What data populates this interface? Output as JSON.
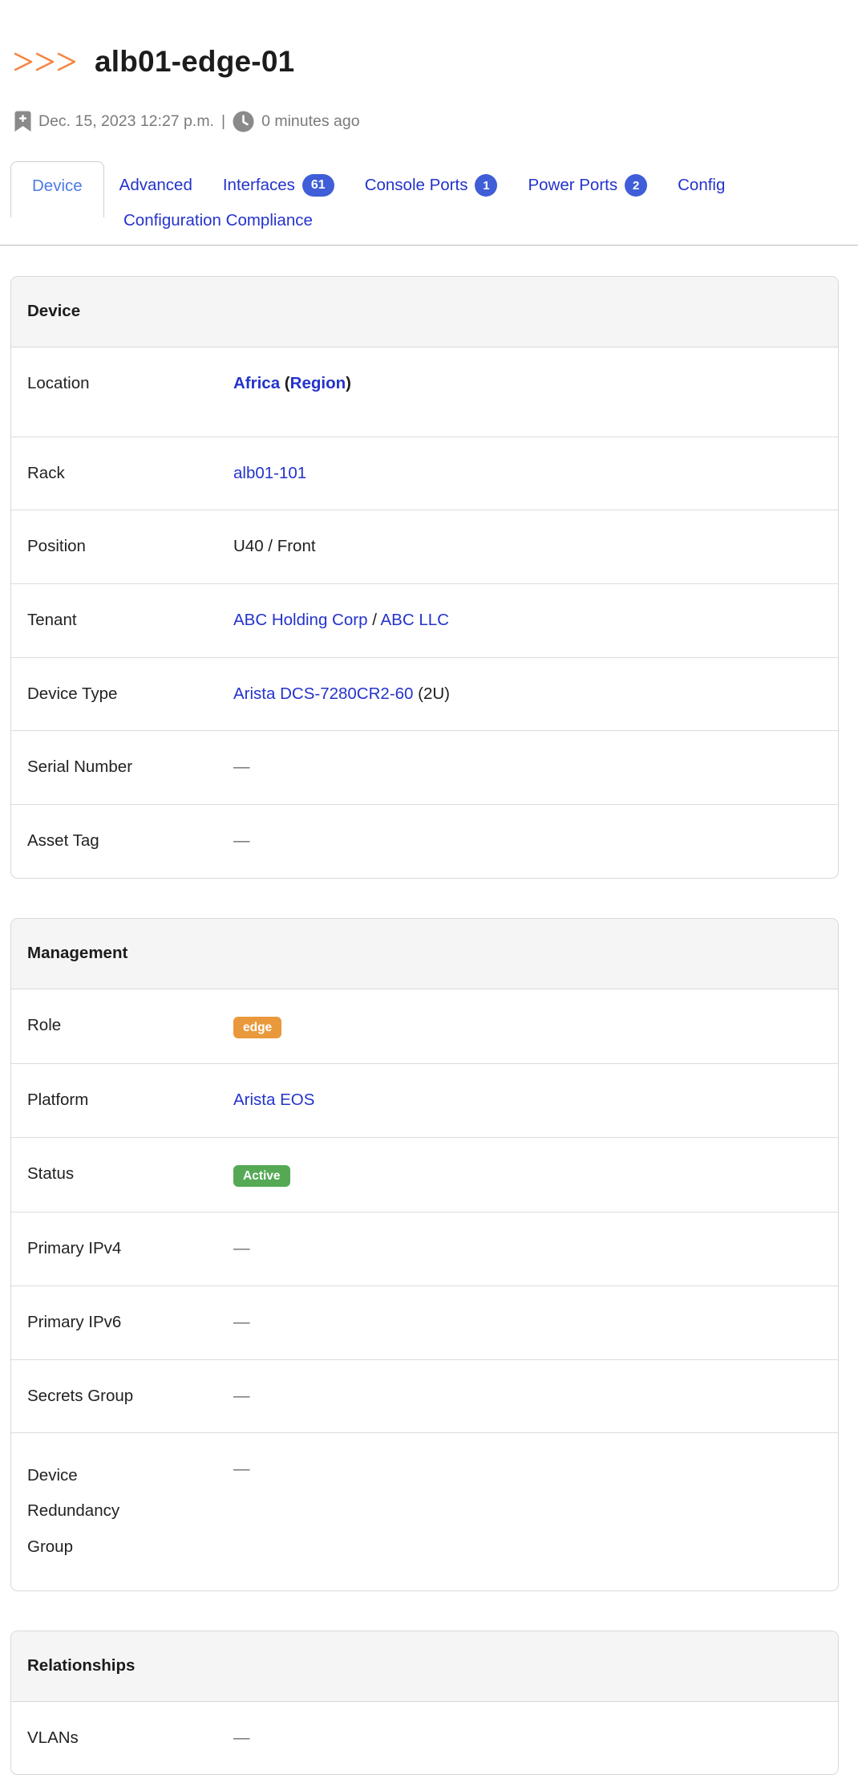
{
  "header": {
    "title": "alb01-edge-01",
    "logo_icon": "triple-chevron-right-icon"
  },
  "meta": {
    "created_icon": "bookmark-plus-icon",
    "created_at": "Dec. 15, 2023 12:27 p.m.",
    "separator": "|",
    "updated_icon": "clock-icon",
    "last_updated": "0 minutes ago"
  },
  "tabs": {
    "row1": [
      {
        "label": "Device",
        "active": true
      },
      {
        "label": "Advanced"
      },
      {
        "label": "Interfaces",
        "badge": "61",
        "badge_shape": "pill"
      },
      {
        "label": "Console Ports",
        "badge": "1",
        "badge_shape": "circle"
      },
      {
        "label": "Power Ports",
        "badge": "2",
        "badge_shape": "circle"
      },
      {
        "label": "Config",
        "clipped": true
      }
    ],
    "row2": [
      {
        "label": "Configuration Compliance"
      }
    ]
  },
  "panels": [
    {
      "title": "Device",
      "rows": [
        {
          "label": "Location",
          "tall": true,
          "parts": [
            {
              "text": "Africa",
              "type": "link",
              "bold": true
            },
            {
              "text": " (",
              "type": "text",
              "bold": true
            },
            {
              "text": "Region",
              "type": "link",
              "bold": true
            },
            {
              "text": ")",
              "type": "text",
              "bold": true
            }
          ]
        },
        {
          "label": "Rack",
          "parts": [
            {
              "text": "alb01-101",
              "type": "link"
            }
          ]
        },
        {
          "label": "Position",
          "parts": [
            {
              "text": "U40 / Front",
              "type": "text"
            }
          ]
        },
        {
          "label": "Tenant",
          "parts": [
            {
              "text": "ABC Holding Corp",
              "type": "link"
            },
            {
              "text": " / ",
              "type": "text"
            },
            {
              "text": "ABC LLC",
              "type": "link"
            }
          ]
        },
        {
          "label": "Device Type",
          "parts": [
            {
              "text": "Arista DCS-7280CR2-60",
              "type": "link"
            },
            {
              "text": " (2U)",
              "type": "text"
            }
          ]
        },
        {
          "label": "Serial Number",
          "parts": [
            {
              "text": "—",
              "type": "empty"
            }
          ]
        },
        {
          "label": "Asset Tag",
          "parts": [
            {
              "text": "—",
              "type": "empty"
            }
          ]
        }
      ]
    },
    {
      "title": "Management",
      "rows": [
        {
          "label": "Role",
          "parts": [
            {
              "text": "edge",
              "type": "badge",
              "color": "#e9993c"
            }
          ]
        },
        {
          "label": "Platform",
          "parts": [
            {
              "text": "Arista EOS",
              "type": "link"
            }
          ]
        },
        {
          "label": "Status",
          "parts": [
            {
              "text": "Active",
              "type": "badge",
              "color": "#55a955"
            }
          ]
        },
        {
          "label": "Primary IPv4",
          "parts": [
            {
              "text": "—",
              "type": "empty"
            }
          ]
        },
        {
          "label": "Primary IPv6",
          "parts": [
            {
              "text": "—",
              "type": "empty"
            }
          ]
        },
        {
          "label": "Secrets Group",
          "parts": [
            {
              "text": "—",
              "type": "empty"
            }
          ]
        },
        {
          "label": "Device Redundancy Group",
          "wrap_label": true,
          "parts": [
            {
              "text": "—",
              "type": "empty"
            }
          ]
        }
      ]
    },
    {
      "title": "Relationships",
      "rows": [
        {
          "label": "VLANs",
          "parts": [
            {
              "text": "—",
              "type": "empty"
            }
          ]
        }
      ]
    }
  ],
  "colors": {
    "link_blue": "#2433cb",
    "active_tab_blue": "#4b7be6",
    "tab_badge_blue": "#3f5ed8",
    "chevron_orange": "#f58442",
    "role_badge_orange": "#e9993c",
    "status_badge_green": "#55a955",
    "muted_gray": "#7a7a7a",
    "panel_header_bg": "#f5f5f6",
    "border_gray": "#d8d8d8"
  }
}
